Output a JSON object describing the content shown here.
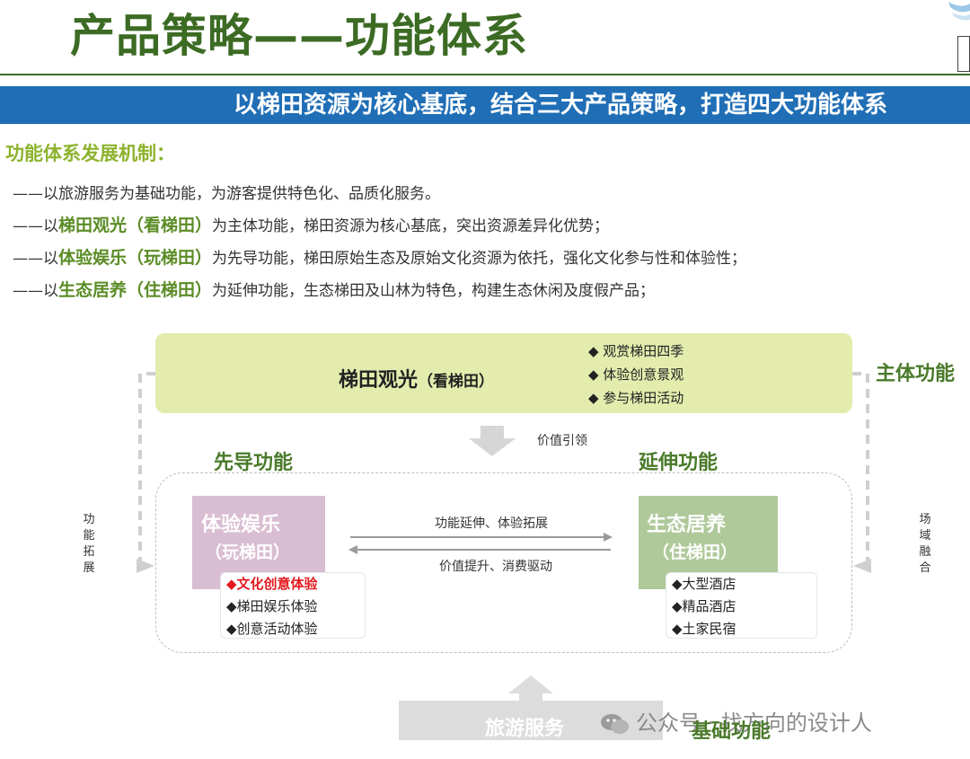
{
  "header": {
    "title": "产品策略——功能体系",
    "banner": "以梯田资源为核心基底，结合三大产品策略，打造四大功能体系"
  },
  "mechanism": {
    "heading": "功能体系发展机制：",
    "lines": [
      {
        "pre": "——以旅游服务为基础功能，为游客提供特色化、品质化服务。",
        "hl": "",
        "post": ""
      },
      {
        "pre": "——以",
        "hl": "梯田观光（看梯田）",
        "post": "为主体功能，梯田资源为核心基底，突出资源差异化优势；"
      },
      {
        "pre": "——以",
        "hl": "体验娱乐（玩梯田）",
        "post": "为先导功能，梯田原始生态及原始文化资源为依托，强化文化参与性和体验性；"
      },
      {
        "pre": "——以",
        "hl": "生态居养（住梯田）",
        "post": "为延伸功能，生态梯田及山林为特色，构建生态休闲及度假产品；"
      }
    ]
  },
  "diagram": {
    "top": {
      "title": "梯田观光",
      "subtitle": "（看梯田）",
      "bullets": [
        "◆  观赏梯田四季",
        "◆  体验创意景观",
        "◆  参与梯田活动"
      ],
      "side_label": "主体功能"
    },
    "value_guide": "价值引领",
    "left": {
      "role": "先导功能",
      "title": "体验娱乐",
      "subtitle": "（玩梯田）",
      "items": [
        "◆文化创意体验",
        "◆梯田娱乐体验",
        "◆创意活动体验"
      ]
    },
    "right": {
      "role": "延伸功能",
      "title": "生态居养",
      "subtitle": "（住梯田）",
      "items": [
        "◆大型酒店",
        "◆精品酒店",
        "◆土家民宿"
      ]
    },
    "arrow_right_label": "功能延伸、体验拓展",
    "arrow_left_label": "价值提升、消费驱动",
    "left_vertical": [
      "功",
      "能",
      "拓",
      "展"
    ],
    "right_vertical": [
      "场",
      "域",
      "融",
      "合"
    ],
    "bottom": {
      "title": "旅游服务",
      "label": "基础功能"
    }
  },
  "watermark": "公众号 · 找方向的设计人",
  "colors": {
    "title_green": "#3c6b24",
    "banner_blue": "#1f6eb6",
    "accent_green": "#8db32e",
    "top_box": "#e3ecad",
    "purple_box": "#d9bdd3",
    "green_box": "#afc99a",
    "highlight_red": "#e3191f"
  }
}
